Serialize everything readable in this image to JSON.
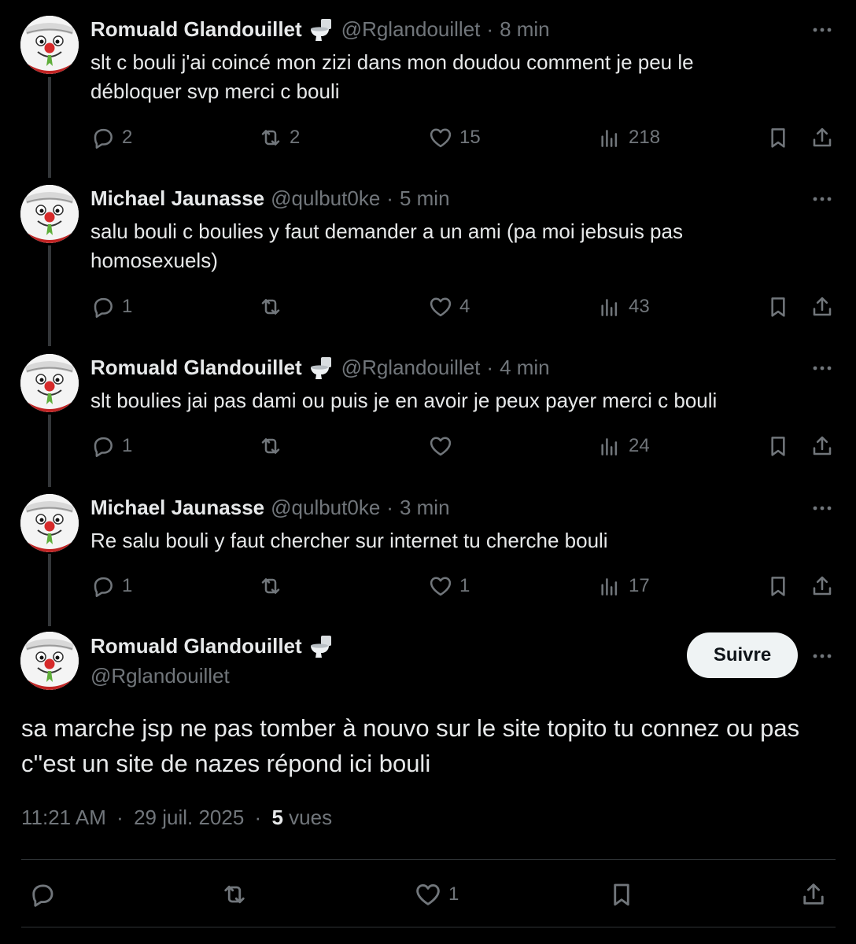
{
  "thread": [
    {
      "name": "Romuald Glandouillet",
      "badge_icon": "toilet-icon",
      "handle": "@Rglandouillet",
      "time": "8 min",
      "text": "slt c bouli j'ai coincé mon zizi dans mon doudou comment je peu le débloquer svp merci c bouli",
      "replies": "2",
      "reposts": "2",
      "likes": "15",
      "views": "218"
    },
    {
      "name": "Michael Jaunasse",
      "handle": "@qulbut0ke",
      "time": "5 min",
      "text": "salu bouli c boulies y faut demander a un ami (pa moi jebsuis pas homosexuels)",
      "replies": "1",
      "reposts": "",
      "likes": "4",
      "views": "43"
    },
    {
      "name": "Romuald Glandouillet",
      "badge_icon": "toilet-icon",
      "handle": "@Rglandouillet",
      "time": "4 min",
      "text": "slt boulies jai pas dami ou puis je en avoir je peux payer merci c bouli",
      "replies": "1",
      "reposts": "",
      "likes": "",
      "views": "24"
    },
    {
      "name": "Michael Jaunasse",
      "handle": "@qulbut0ke",
      "time": "3 min",
      "text": "Re salu bouli y faut chercher sur internet tu cherche bouli",
      "replies": "1",
      "reposts": "",
      "likes": "1",
      "views": "17"
    }
  ],
  "separator": "·",
  "main": {
    "name": "Romuald Glandouillet",
    "badge_icon": "toilet-icon",
    "handle": "@Rglandouillet",
    "follow_label": "Suivre",
    "text": "sa marche jsp ne pas tomber à nouvo sur le site topito tu connez ou pas c''est un site de nazes répond ici bouli",
    "time": "11:21 AM",
    "date": "29 juil. 2025",
    "views_count": "5",
    "views_label": "vues",
    "likes": "1"
  },
  "colors": {
    "background": "#000000",
    "text": "#e7e9ea",
    "muted": "#71767b",
    "divider": "#2f3336",
    "button_bg": "#eff3f4"
  }
}
